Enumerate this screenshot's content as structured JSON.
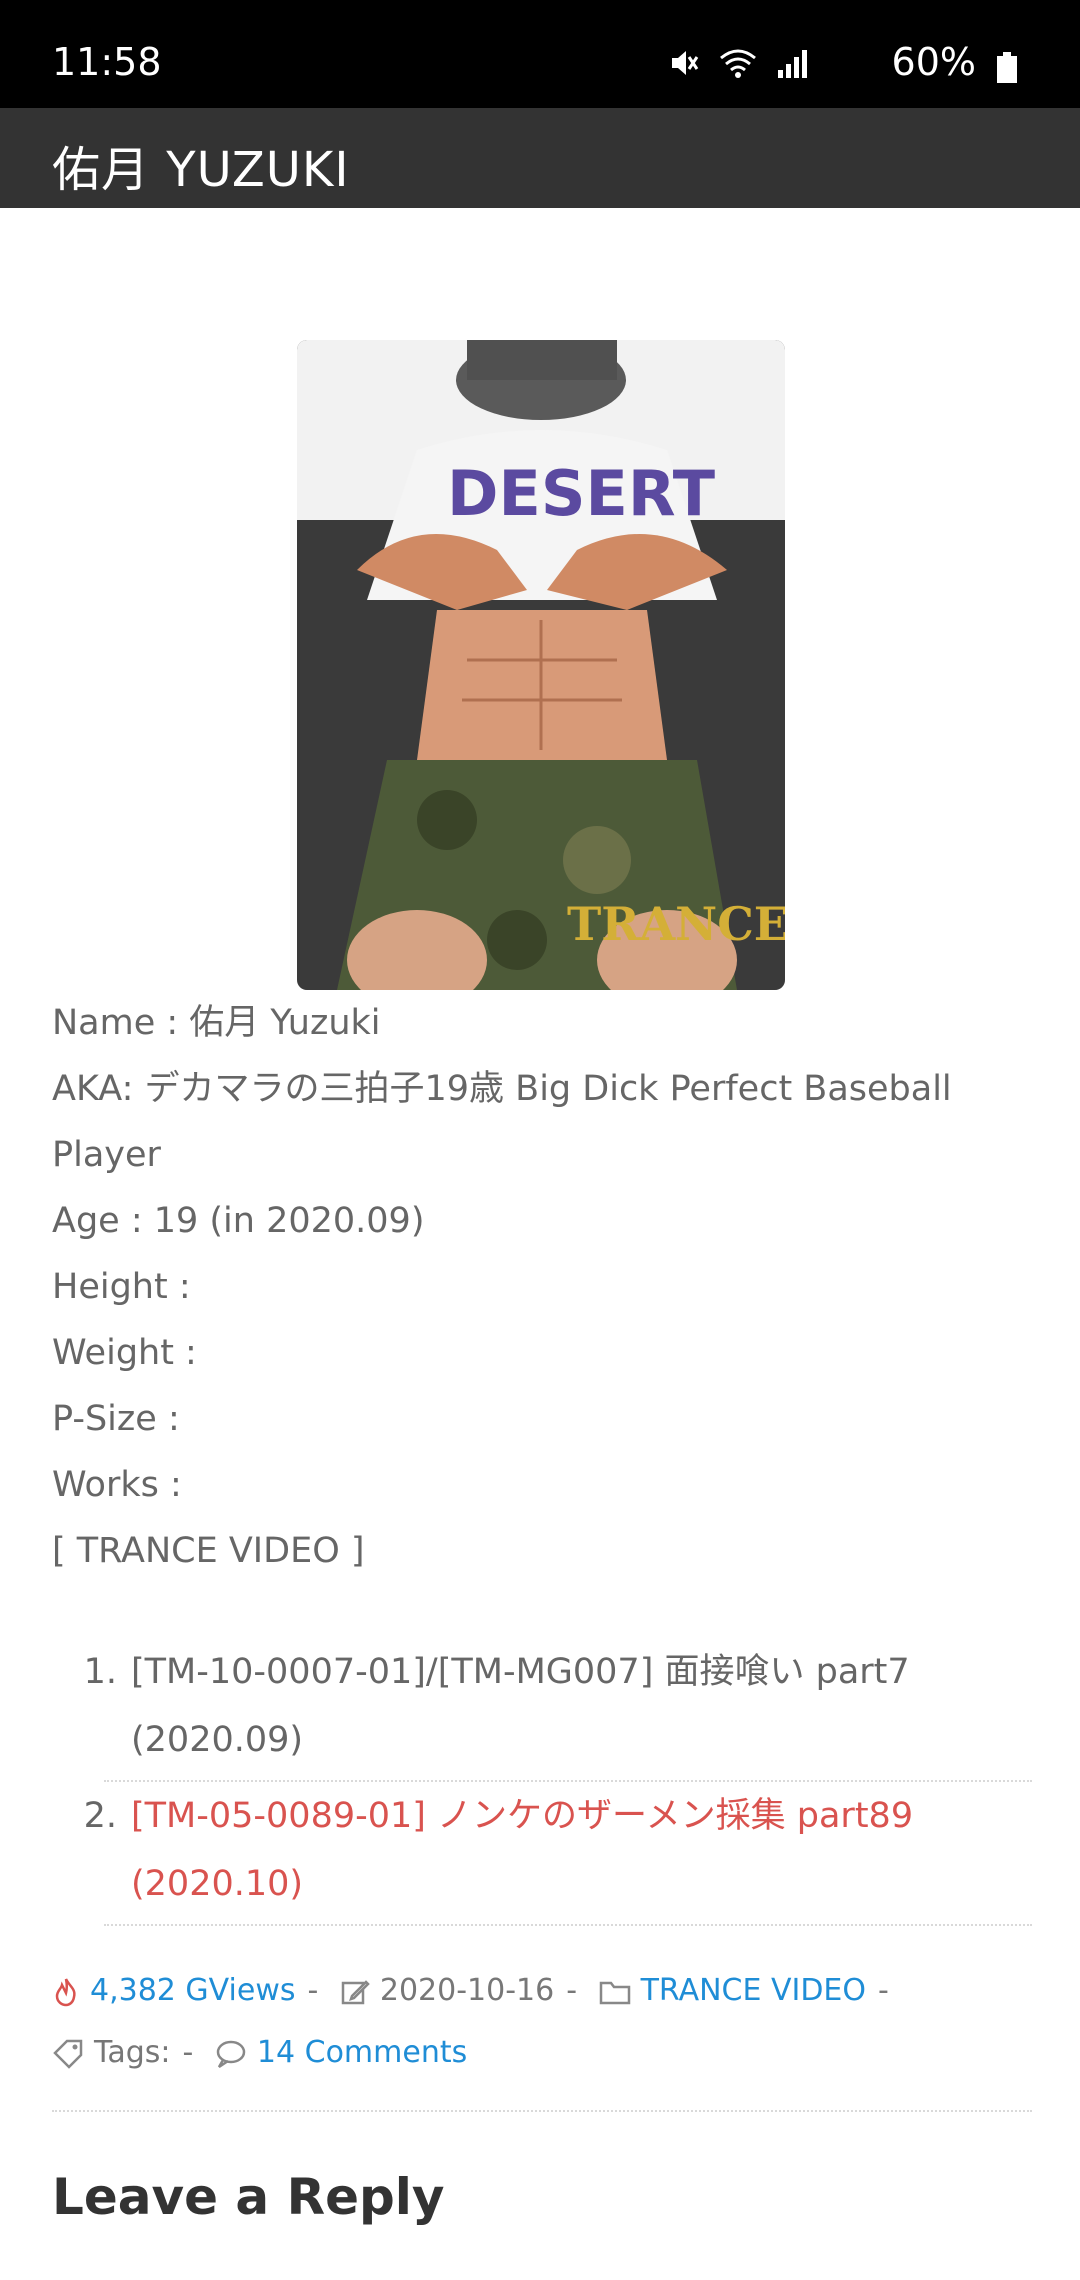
{
  "status": {
    "time": "11:58",
    "battery": "60%"
  },
  "appbar": {
    "title": "佑月 YUZUKI"
  },
  "profile": {
    "name": "Name : 佑月 Yuzuki",
    "aka_line1": "AKA: デカマラの三拍子19歳 Big Dick Perfect Baseball",
    "aka_line2": "Player",
    "age": "Age :  19 (in 2020.09)",
    "height": "Height :",
    "weight": "Weight :",
    "psize": "P-Size :",
    "works": "Works :",
    "label": "[ TRANCE VIDEO ]"
  },
  "photo": {
    "logo_text": "TRANCE",
    "shirt_text": "DESERT"
  },
  "works": [
    {
      "num": "1.",
      "line1": "[TM-10-0007-01]/[TM-MG007] 面接喰い part7",
      "line2": "(2020.09)"
    },
    {
      "num": "2.",
      "line1": "[TM-05-0089-01] ノンケのザーメン採集 part89",
      "line2": "(2020.10)"
    }
  ],
  "meta": {
    "views": "4,382 GViews",
    "date": "2020-10-16",
    "category": "TRANCE VIDEO",
    "tags_label": "Tags:",
    "comments": "14 Comments",
    "sep": "-"
  },
  "reply": {
    "heading": "Leave a Reply"
  }
}
